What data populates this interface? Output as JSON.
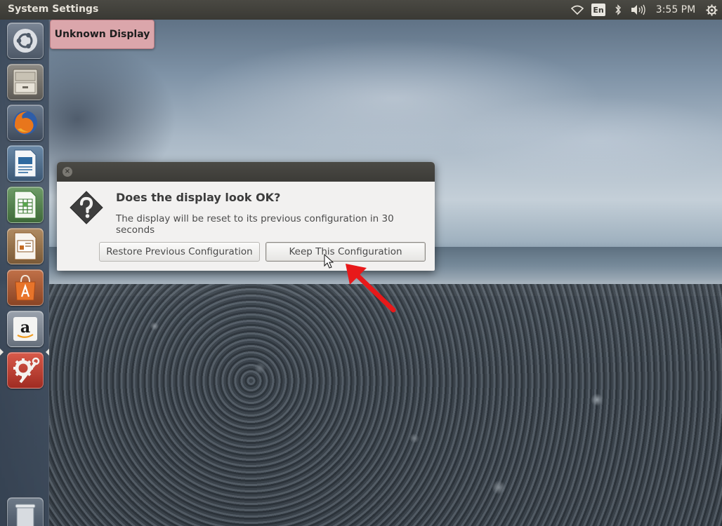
{
  "panel": {
    "app_title": "System Settings",
    "keyboard_layout": "En",
    "clock": "3:55 PM",
    "indicators": [
      "wifi-icon",
      "keyboard-layout",
      "bluetooth-icon",
      "volume-icon",
      "clock",
      "session-gear-icon"
    ]
  },
  "launcher": {
    "items": [
      {
        "name": "dash-home",
        "icon": "ubuntu-logo-icon"
      },
      {
        "name": "files",
        "icon": "file-cabinet-icon"
      },
      {
        "name": "firefox",
        "icon": "firefox-icon"
      },
      {
        "name": "libreoffice-writer",
        "icon": "writer-document-icon"
      },
      {
        "name": "libreoffice-calc",
        "icon": "calc-spreadsheet-icon"
      },
      {
        "name": "libreoffice-impress",
        "icon": "impress-presentation-icon"
      },
      {
        "name": "software-center",
        "icon": "shopping-bag-icon"
      },
      {
        "name": "amazon",
        "icon": "amazon-logo-icon"
      },
      {
        "name": "system-settings",
        "icon": "settings-tools-icon",
        "active": true
      },
      {
        "name": "trash",
        "icon": "trash-icon"
      }
    ]
  },
  "display_label": "Unknown Display",
  "dialog": {
    "heading": "Does the display look OK?",
    "message": "The display will be reset to its previous configuration in 30 seconds",
    "close_icon": "close-icon",
    "icon": "question-icon",
    "buttons": {
      "restore": "Restore Previous Configuration",
      "keep": "Keep This Configuration"
    }
  },
  "colors": {
    "panel_bg": "#3c3b37",
    "dialog_bg": "#f2f1f0",
    "display_label_bg": "#dba6ab",
    "annotation_arrow": "#e8191a",
    "active_launcher_tile": "#c8392b"
  }
}
